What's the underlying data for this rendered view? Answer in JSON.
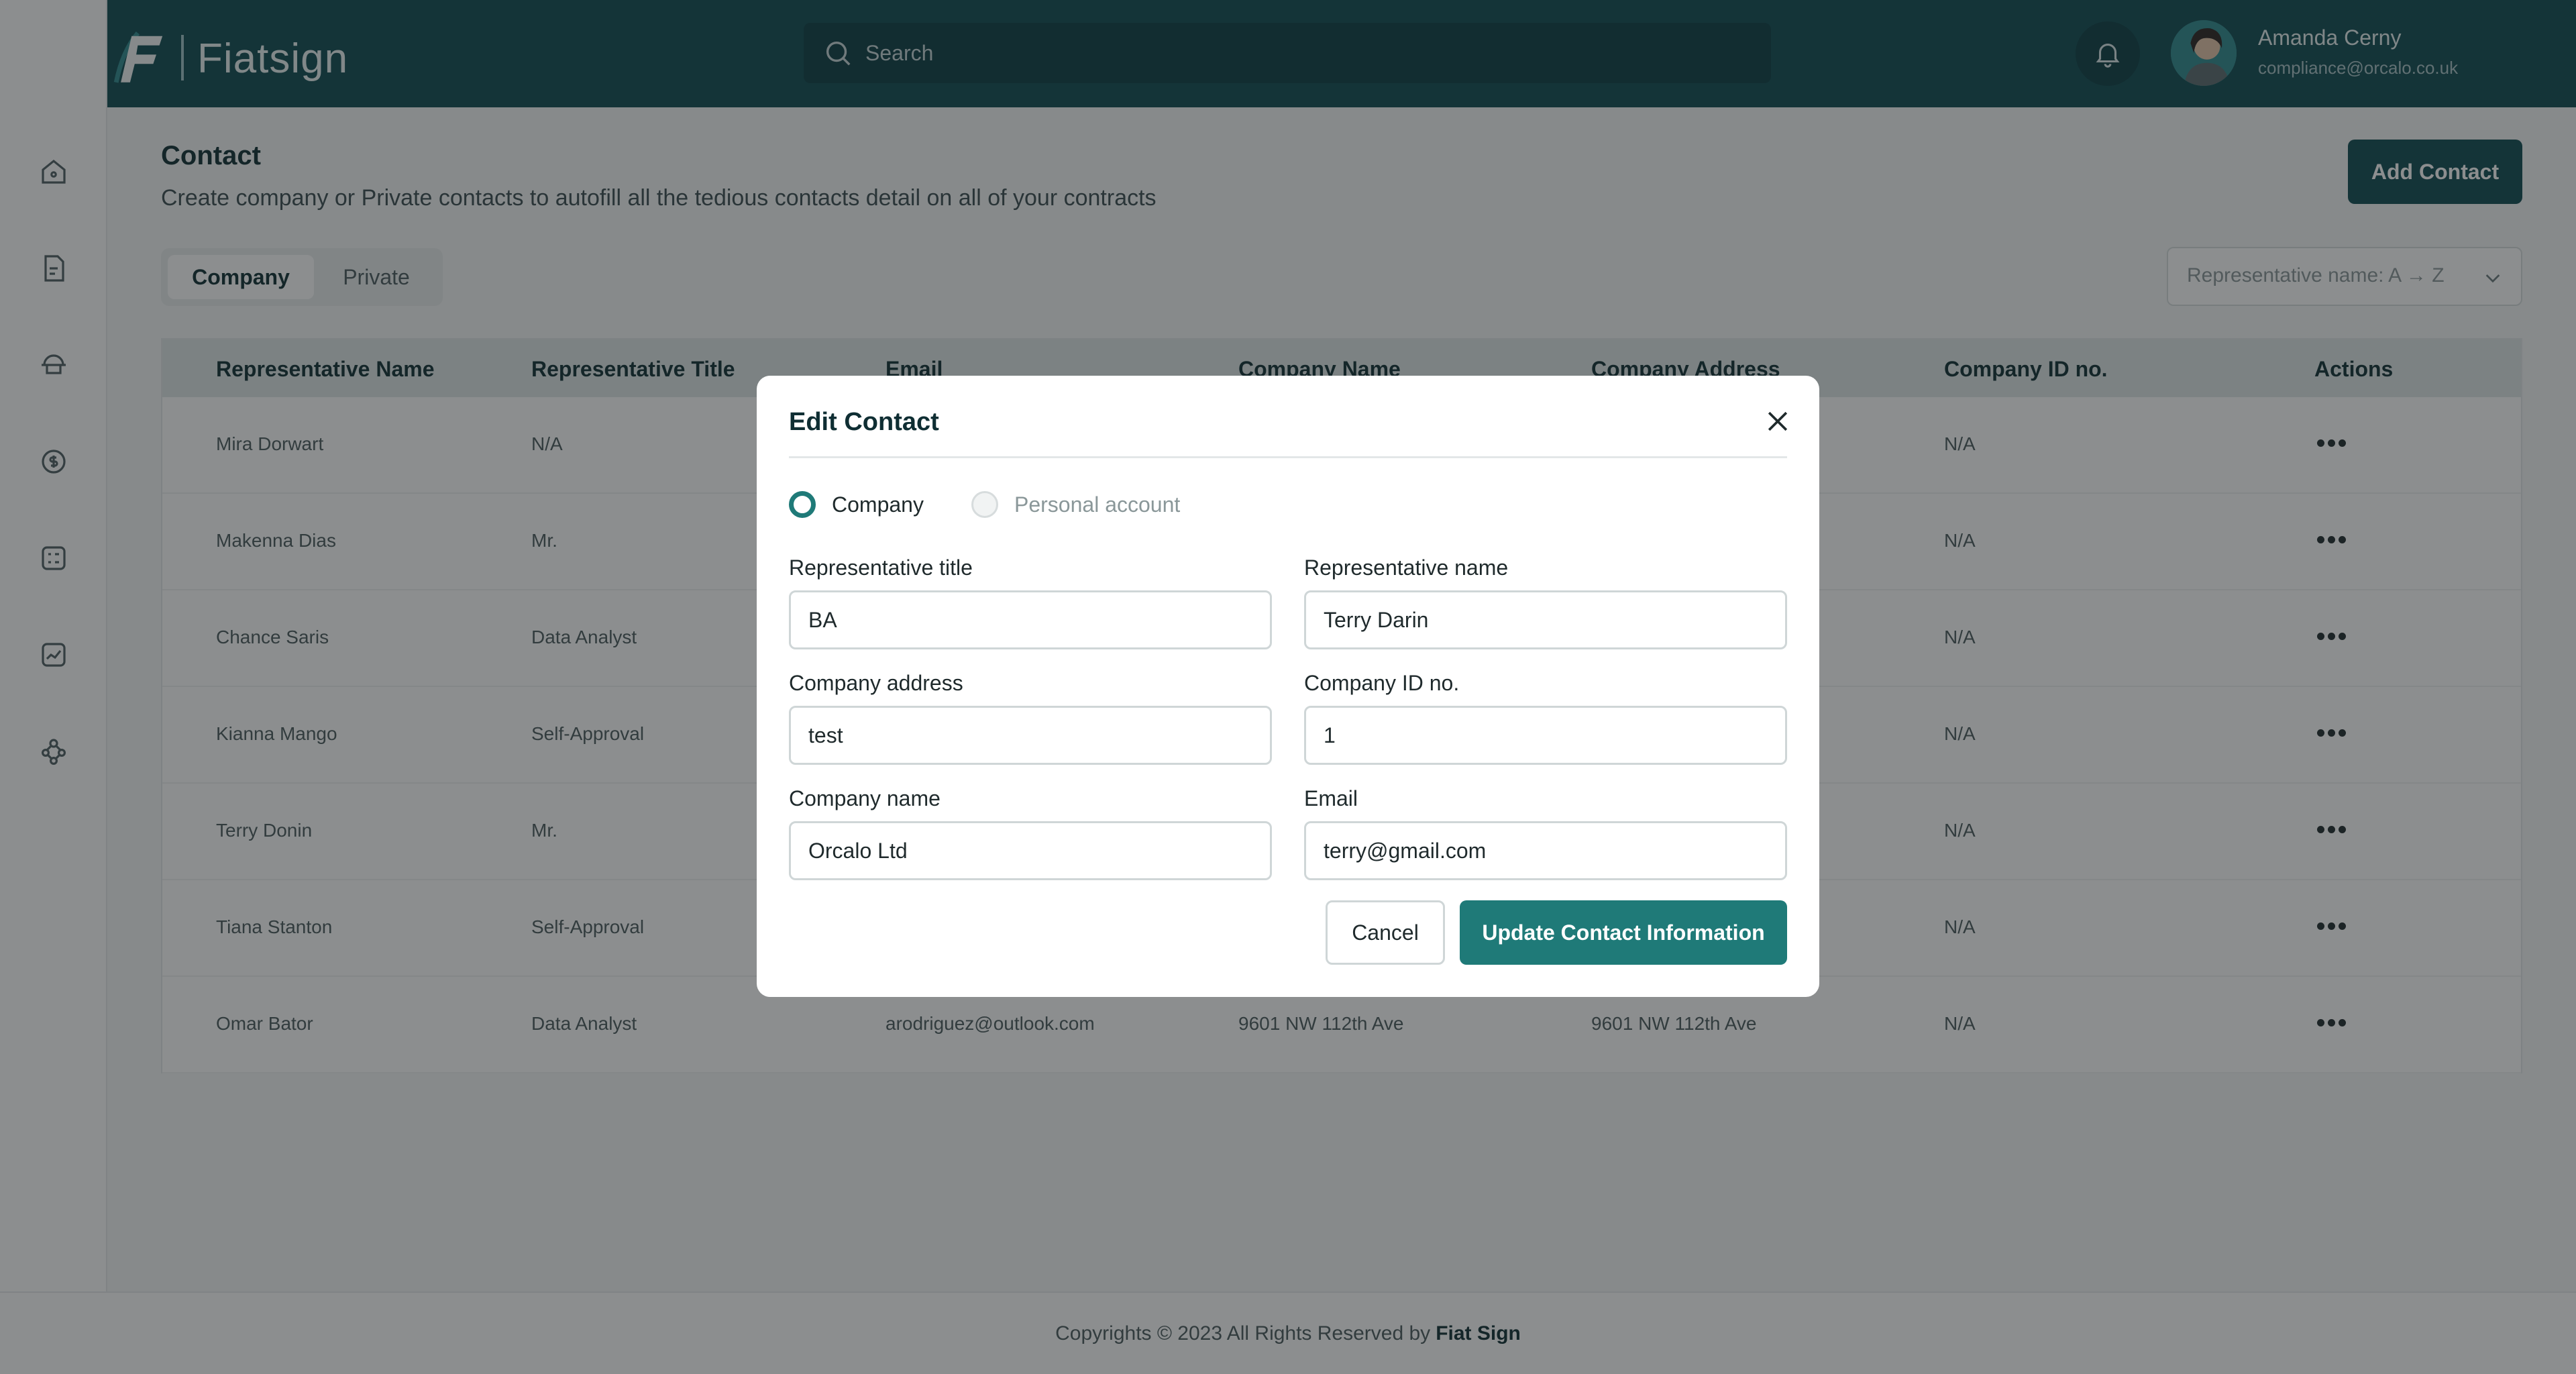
{
  "colors": {
    "header_bg": "#0e4a51",
    "accent": "#1f7a78",
    "overlay": "rgba(25,30,32,0.5)"
  },
  "sidebar": {
    "icons": [
      "home-icon",
      "document-icon",
      "signature-icon",
      "dollar-icon",
      "checklist-icon",
      "chart-icon",
      "team-icon"
    ]
  },
  "header": {
    "logo_text": "Fiatsign",
    "search_placeholder": "Search",
    "user_name": "Amanda Cerny",
    "user_email": "compliance@orcalo.co.uk"
  },
  "page": {
    "title": "Contact",
    "subtitle": "Create company or Private contacts to autofill all the tedious contacts detail on all of your contracts",
    "add_button": "Add Contact",
    "tabs": [
      "Company",
      "Private"
    ],
    "sort_label": "Representative name: A → Z"
  },
  "table": {
    "headers": [
      "Representative Name",
      "Representative Title",
      "Email",
      "Company Name",
      "Company Address",
      "Company ID no.",
      "Actions"
    ],
    "rows": [
      {
        "name": "Mira Dorwart",
        "title": "N/A",
        "id": "N/A"
      },
      {
        "name": "Makenna Dias",
        "title": "Mr.",
        "id": "N/A"
      },
      {
        "name": "Chance Saris",
        "title": "Data Analyst",
        "id": "N/A"
      },
      {
        "name": "Kianna Mango",
        "title": "Self-Approval",
        "id": "N/A"
      },
      {
        "name": "Terry Donin",
        "title": "Mr.",
        "id": "N/A"
      },
      {
        "name": "Tiana Stanton",
        "title": "Self-Approval",
        "id": "N/A"
      },
      {
        "name": "Omar Bator",
        "title": "Data Analyst",
        "email": "arodriguez@outlook.com",
        "company": "9601 NW 112th Ave",
        "address": "9601 NW 112th Ave",
        "id": "N/A"
      }
    ]
  },
  "footer": {
    "text": "Copyrights © 2023 All Rights Reserved by",
    "brand": "Fiat Sign"
  },
  "modal": {
    "title": "Edit Contact",
    "account_types": [
      "Company",
      "Personal account"
    ],
    "fields": {
      "rep_title": {
        "label": "Representative title",
        "value": "BA"
      },
      "rep_name": {
        "label": "Representative name",
        "value": "Terry Darin"
      },
      "company_address": {
        "label": "Company address",
        "value": "test"
      },
      "company_id": {
        "label": "Company ID no.",
        "value": "1"
      },
      "company_name": {
        "label": "Company name",
        "value": "Orcalo Ltd"
      },
      "email": {
        "label": "Email",
        "value": "terry@gmail.com"
      }
    },
    "cancel_label": "Cancel",
    "update_label": "Update Contact Information"
  }
}
